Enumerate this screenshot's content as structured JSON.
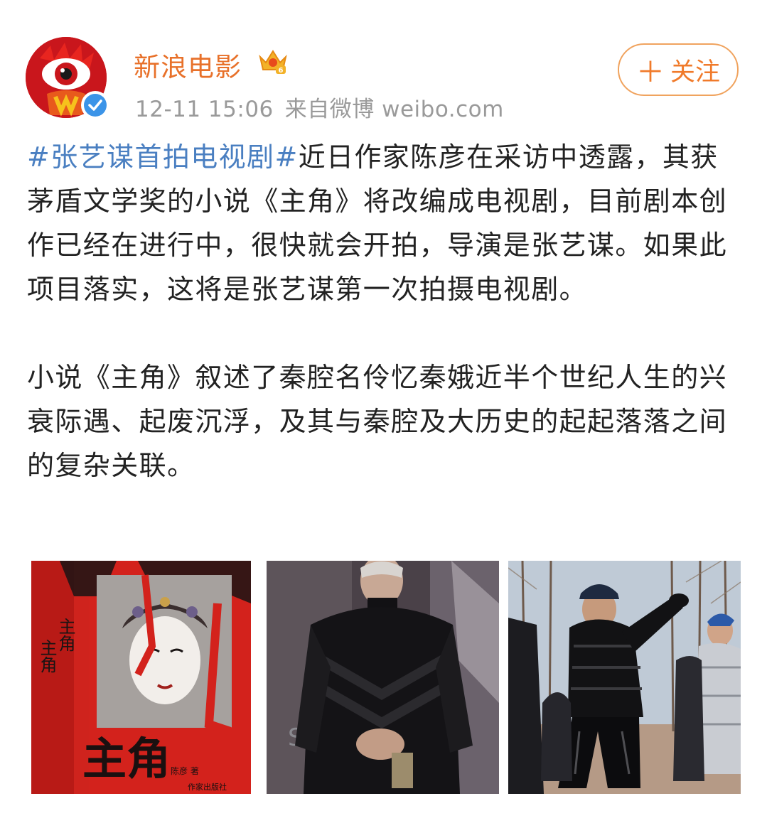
{
  "post": {
    "username": "新浪电影",
    "timestamp": "12-11 15:06",
    "source": "来自微博 weibo.com",
    "follow_label": "关注",
    "follow_plus": "＋",
    "hashtag": "#张艺谋首拍电视剧#",
    "paragraph1_rest": "近日作家陈彦在采访中透露，其获茅盾文学奖的小说《主角》将改编成电视剧，目前剧本创作已经在进行中，很快就会开拍，导演是张艺谋。如果此项目落实，这将是张艺谋第一次拍摄电视剧。",
    "paragraph2": "小说《主角》叙述了秦腔名伶忆秦娥近半个世纪人生的兴衰际遇、起废沉浮，及其与秦腔及大历史的起起落落之间的复杂关联。"
  },
  "images": {
    "book_title": "主角",
    "book_spine_1": "主角",
    "book_spine_2": "主角",
    "book_author": "陈彦 著",
    "book_publisher": "作家出版社",
    "backdrop_text": "SE"
  },
  "icons": {
    "avatar": "sina-eye-logo",
    "verified": "verified-check-icon",
    "vip": "crown-icon"
  },
  "colors": {
    "username": "#e8712a",
    "hashtag": "#4a7fc1",
    "follow": "#f07a2a",
    "verified": "#3b94e8"
  }
}
